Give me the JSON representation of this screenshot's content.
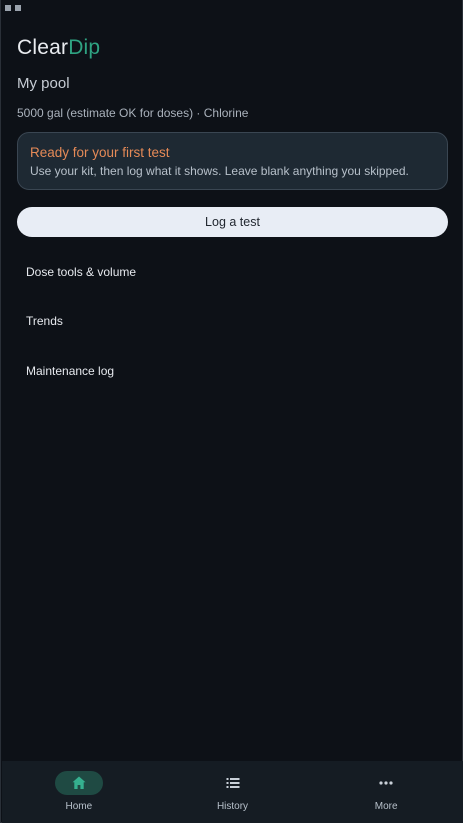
{
  "app": {
    "brand_part1": "Clear",
    "brand_part2": "Dip",
    "brand_colors": {
      "part1": "#e9ecf0",
      "part2": "#2fa382"
    }
  },
  "pool": {
    "name": "My pool",
    "info": "5000 gal (estimate OK for doses) · Chlorine"
  },
  "notice": {
    "title": "Ready for your first test",
    "body": "Use your kit, then log what it shows. Leave blank anything you skipped.",
    "accent_color": "#e58a57"
  },
  "actions": {
    "log_test_label": "Log a test"
  },
  "menu": {
    "items": [
      {
        "label": "Dose tools & volume"
      },
      {
        "label": "Trends"
      },
      {
        "label": "Maintenance log"
      }
    ]
  },
  "nav": {
    "items": [
      {
        "label": "Home",
        "icon": "home-icon",
        "active": true
      },
      {
        "label": "History",
        "icon": "list-icon",
        "active": false
      },
      {
        "label": "More",
        "icon": "more-icon",
        "active": false
      }
    ],
    "active_color": "#1f4a43"
  }
}
